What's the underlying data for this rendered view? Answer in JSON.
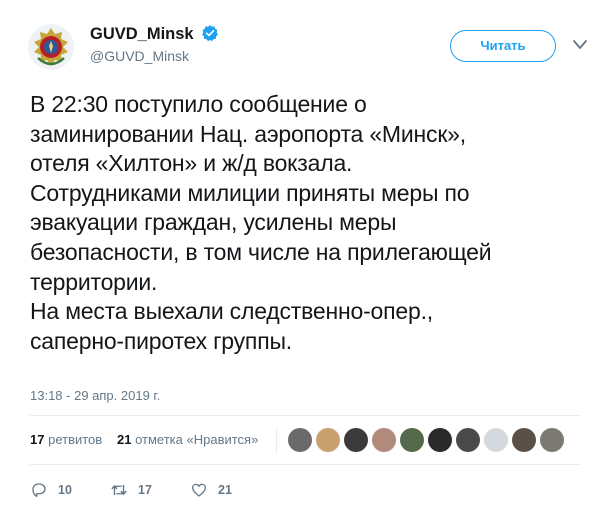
{
  "author": {
    "display_name": "GUVD_Minsk",
    "handle": "@GUVD_Minsk",
    "verified": true
  },
  "follow_button": {
    "label": "Читать"
  },
  "tweet": {
    "lines": [
      "В 22:30 поступило сообщение о",
      "заминировании Нац. аэропорта «Минск»,",
      "отеля «Хилтон» и ж/д вокзала.",
      "Сотрудниками милиции приняты меры по",
      "эвакуации граждан, усилены меры",
      "безопасности, в том числе на прилегающей",
      "территории.",
      "На места выехали следственно-опер.,",
      "саперно-пиротех группы."
    ],
    "timestamp": "13:18 - 29 апр. 2019 г."
  },
  "stats": {
    "retweets_count": "17",
    "retweets_label": "ретвитов",
    "likes_count": "21",
    "likes_label": "отметка «Нравится»"
  },
  "actions": {
    "reply_count": "10",
    "retweet_count": "17",
    "like_count": "21"
  },
  "colors": {
    "accent": "#1da1f2",
    "text": "#14171a",
    "secondary": "#657786",
    "divider": "#e6ecf0"
  }
}
